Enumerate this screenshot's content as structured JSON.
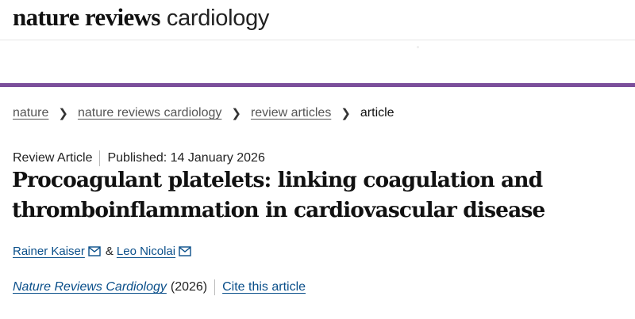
{
  "header": {
    "logo_bold": "nature reviews",
    "logo_light": "cardiology"
  },
  "breadcrumb": {
    "items": [
      "nature",
      "nature reviews cardiology",
      "review articles"
    ],
    "current": "article"
  },
  "article_meta": {
    "type": "Review Article",
    "published": "Published: 14 January 2026"
  },
  "title": {
    "line1": "Procoagulant platelets: linking coagulation and",
    "line2": "thromboinflammation in cardiovascular disease"
  },
  "authors": [
    {
      "name": "Rainer Kaiser",
      "icon": "mail-icon"
    },
    {
      "name": "Leo Nicolai",
      "icon": "mail-icon"
    }
  ],
  "author_separator": "&",
  "citation": {
    "journal": "Nature Reviews Cardiology",
    "year": "(2026)",
    "cite_label": "Cite this article"
  },
  "colors": {
    "accent": "#7b4f9b",
    "link": "#0a4f8a"
  }
}
